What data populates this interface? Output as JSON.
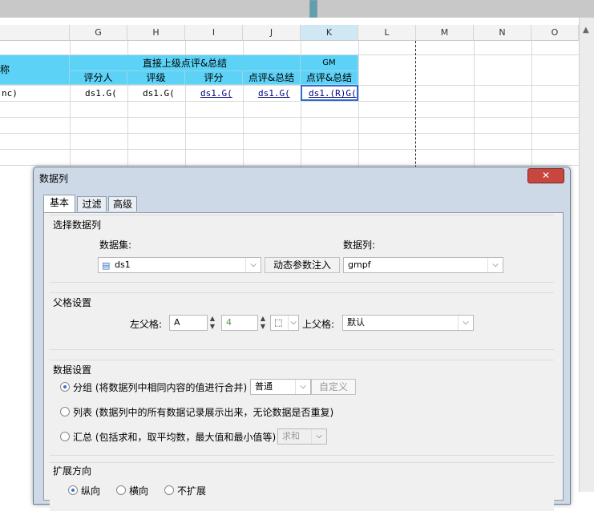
{
  "sheet": {
    "columns": [
      "G",
      "H",
      "I",
      "J",
      "K",
      "L",
      "M",
      "N",
      "O"
    ],
    "header_left": "称",
    "header_group": "直接上级点评&总结",
    "header_gm": "GM",
    "subheaders": [
      "评分人",
      "评级",
      "评分",
      "点评&总结",
      "点评&总结"
    ],
    "row_cells": [
      "nc)",
      "ds1.G(",
      "ds1.G(",
      "ds1.G(",
      "ds1.G(",
      "ds1.(R)G("
    ]
  },
  "dialog": {
    "title": "数据列",
    "close_glyph": "✕",
    "tabs": [
      "基本",
      "过滤",
      "高级"
    ],
    "select_section": {
      "title": "选择数据列",
      "dataset_label": "数据集:",
      "dataset_value": "ds1",
      "inject_button": "动态参数注入",
      "column_label": "数据列:",
      "column_value": "gmpf"
    },
    "parent_section": {
      "title": "父格设置",
      "left_label": "左父格:",
      "left_col": "A",
      "left_row": "4",
      "up_label": "上父格:",
      "up_value": "默认"
    },
    "data_section": {
      "title": "数据设置",
      "group_option": "分组 (将数据列中相同内容的值进行合并)",
      "group_mode": "普通",
      "custom_button": "自定义",
      "list_option": "列表 (数据列中的所有数据记录展示出来，无论数据是否重复)",
      "summary_option": "汇总 (包括求和，取平均数，最大值和最小值等)",
      "summary_mode": "求和"
    },
    "expand_section": {
      "title": "扩展方向",
      "options": [
        "纵向",
        "横向",
        "不扩展"
      ]
    }
  }
}
